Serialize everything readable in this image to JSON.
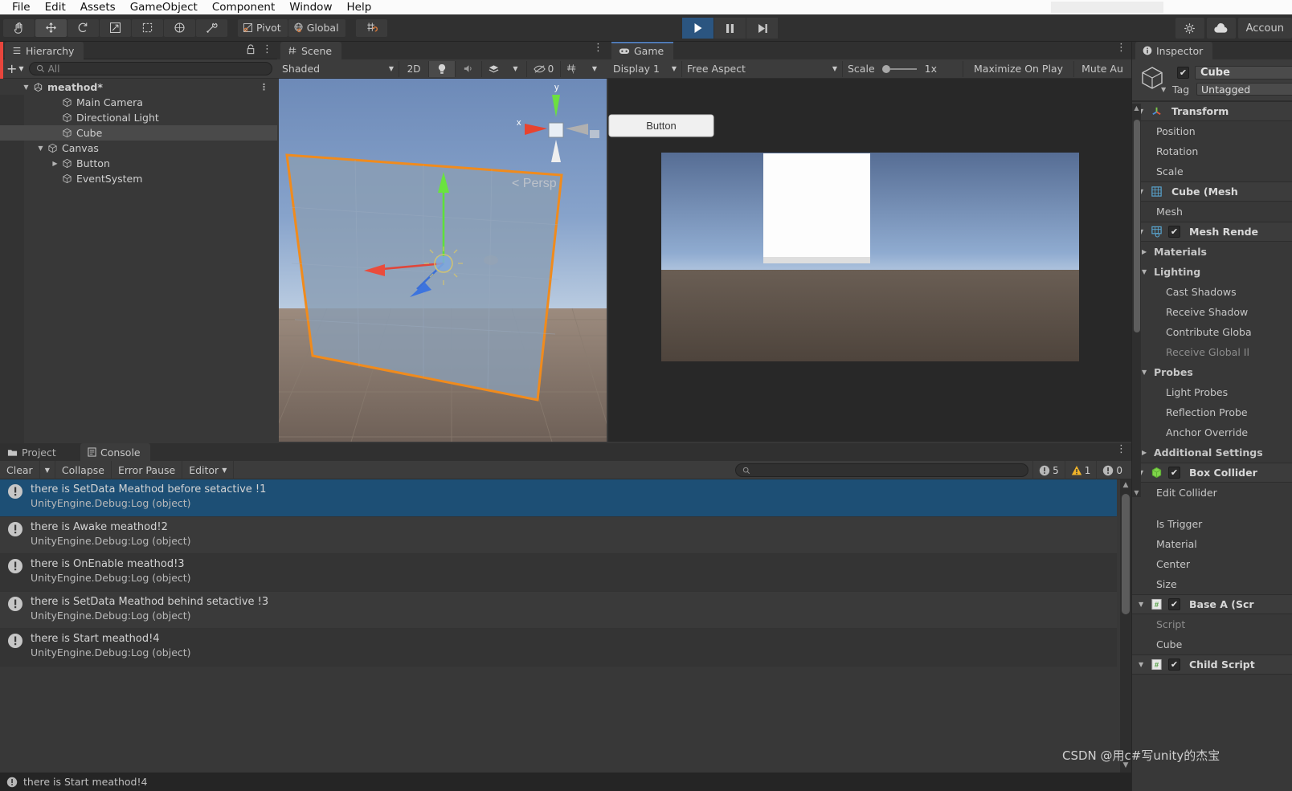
{
  "menu": {
    "items": [
      "File",
      "Edit",
      "Assets",
      "GameObject",
      "Component",
      "Window",
      "Help"
    ]
  },
  "toolbar": {
    "tools": [
      {
        "name": "hand-tool",
        "glyph": "✋"
      },
      {
        "name": "move-tool",
        "glyph": "✥"
      },
      {
        "name": "rotate-tool",
        "glyph": "↺"
      },
      {
        "name": "scale-tool",
        "glyph": "⤢"
      },
      {
        "name": "rect-tool",
        "glyph": "⬚"
      },
      {
        "name": "transform-tool",
        "glyph": "◎"
      },
      {
        "name": "custom-tool",
        "glyph": "🛠"
      }
    ],
    "pivot_label": "Pivot",
    "global_label": "Global",
    "play_label": "▶",
    "pause_label": "❚❚",
    "step_label": "▶❙",
    "account_label": "Accoun"
  },
  "hierarchy": {
    "tab_label": "Hierarchy",
    "search_placeholder": "All",
    "add_label": "+",
    "items": [
      {
        "label": "meathod*",
        "depth": 0,
        "expanded": true,
        "selected": false,
        "root": true
      },
      {
        "label": "Main Camera",
        "depth": 2,
        "expanded": null,
        "selected": false,
        "root": false
      },
      {
        "label": "Directional Light",
        "depth": 2,
        "expanded": null,
        "selected": false,
        "root": false
      },
      {
        "label": "Cube",
        "depth": 2,
        "expanded": null,
        "selected": true,
        "root": false
      },
      {
        "label": "Canvas",
        "depth": 1,
        "expanded": true,
        "selected": false,
        "root": false
      },
      {
        "label": "Button",
        "depth": 2,
        "expanded": false,
        "selected": false,
        "root": false
      },
      {
        "label": "EventSystem",
        "depth": 2,
        "expanded": null,
        "selected": false,
        "root": false
      }
    ]
  },
  "scene": {
    "tab_label": "Scene",
    "shading_mode": "Shaded",
    "mode_2d": "2D",
    "hidden_count": "0",
    "persp_label": "Persp",
    "axis_x": "x",
    "axis_y": "y"
  },
  "game": {
    "tab_label": "Game",
    "display": "Display 1",
    "aspect": "Free Aspect",
    "scale_label": "Scale",
    "scale_value": "1x",
    "maximize_label": "Maximize On Play",
    "mute_label": "Mute Au",
    "ui_button_label": "Button"
  },
  "console": {
    "project_tab": "Project",
    "console_tab": "Console",
    "clear_label": "Clear",
    "collapse_label": "Collapse",
    "error_pause_label": "Error Pause",
    "editor_label": "Editor",
    "search_placeholder": "",
    "counts": {
      "log": "5",
      "warning": "1",
      "error": "0"
    },
    "logs": [
      {
        "main": "there is  SetData  Meathod before setactive !1",
        "sub": "UnityEngine.Debug:Log (object)",
        "selected": true
      },
      {
        "main": "there  is  Awake  meathod!2",
        "sub": "UnityEngine.Debug:Log (object)",
        "selected": false
      },
      {
        "main": "there is  OnEnable meathod!3",
        "sub": "UnityEngine.Debug:Log (object)",
        "selected": false
      },
      {
        "main": "there is  SetData  Meathod behind setactive !3",
        "sub": "UnityEngine.Debug:Log (object)",
        "selected": false
      },
      {
        "main": "there is Start meathod!4",
        "sub": "UnityEngine.Debug:Log (object)",
        "selected": false
      }
    ],
    "status_text": "there is Start meathod!4"
  },
  "inspector": {
    "tab_label": "Inspector",
    "object_name": "Cube",
    "tag_label": "Tag",
    "tag_value": "Untagged",
    "components": [
      {
        "title": "Transform",
        "icon": "transform-icon",
        "checkbox": false,
        "rows": [
          {
            "label": "Position",
            "style": ""
          },
          {
            "label": "Rotation",
            "style": ""
          },
          {
            "label": "Scale",
            "style": ""
          }
        ]
      },
      {
        "title": "Cube (Mesh",
        "icon": "mesh-filter-icon",
        "checkbox": false,
        "rows": [
          {
            "label": "Mesh",
            "style": ""
          }
        ]
      },
      {
        "title": "Mesh Rende",
        "icon": "mesh-renderer-icon",
        "checkbox": true,
        "rows": [
          {
            "label": "Materials",
            "style": "ind",
            "tri": "▶"
          },
          {
            "label": "Lighting",
            "style": "ind",
            "tri": "▼"
          },
          {
            "label": "Cast Shadows",
            "style": "sub"
          },
          {
            "label": "Receive Shadow",
            "style": "sub"
          },
          {
            "label": "Contribute Globa",
            "style": "sub"
          },
          {
            "label": "Receive Global Il",
            "style": "sub dim"
          },
          {
            "label": "Probes",
            "style": "ind",
            "tri": "▼"
          },
          {
            "label": "Light Probes",
            "style": "sub"
          },
          {
            "label": "Reflection Probe",
            "style": "sub"
          },
          {
            "label": "Anchor Override",
            "style": "sub"
          },
          {
            "label": "Additional Settings",
            "style": "ind",
            "tri": "▶"
          }
        ]
      },
      {
        "title": "Box Collider",
        "icon": "box-collider-icon",
        "checkbox": true,
        "rows": [
          {
            "label": "Edit Collider",
            "style": ""
          },
          {
            "label": "",
            "style": "spacer"
          },
          {
            "label": "Is Trigger",
            "style": ""
          },
          {
            "label": "Material",
            "style": ""
          },
          {
            "label": "Center",
            "style": ""
          },
          {
            "label": "Size",
            "style": ""
          }
        ]
      },
      {
        "title": "Base A (Scr",
        "icon": "script-icon",
        "checkbox": true,
        "rows": [
          {
            "label": "Script",
            "style": "dim"
          },
          {
            "label": "Cube",
            "style": ""
          }
        ]
      },
      {
        "title": "Child Script",
        "icon": "script-icon",
        "checkbox": true,
        "rows": []
      }
    ]
  },
  "watermark": "CSDN @用c#写unity的杰宝"
}
